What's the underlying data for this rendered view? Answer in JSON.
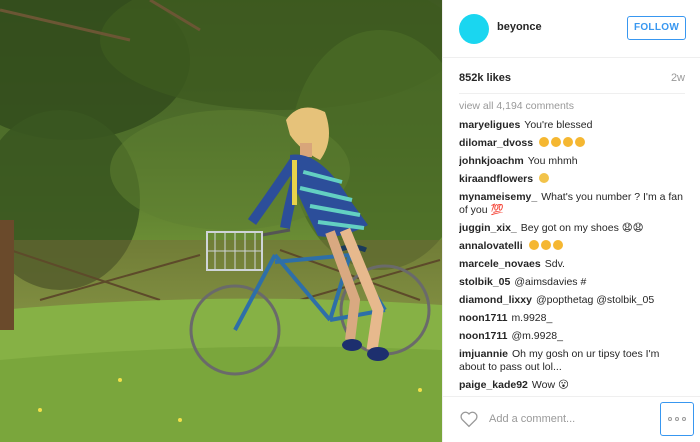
{
  "post": {
    "username": "beyonce",
    "follow_label": "FOLLOW",
    "likes": "852k likes",
    "age": "2w",
    "view_all": "view all 4,194 comments",
    "avatar_color": "#1ad6f0",
    "accent_color": "#3897f0"
  },
  "comments": [
    {
      "user": "maryeligues",
      "text": "You're blessed"
    },
    {
      "user": "dilomar_dvoss",
      "text": "",
      "emoji": [
        "heart-eyes-emoji",
        "heart-eyes-emoji",
        "heart-eyes-emoji",
        "heart-eyes-emoji"
      ]
    },
    {
      "user": "johnkjoachm",
      "text": "You mhmh"
    },
    {
      "user": "kiraandflowers",
      "text": "",
      "emoji": [
        "tongue-emoji"
      ]
    },
    {
      "user": "mynameisemy_",
      "text": "What's you number ? I'm a fan of you 💯"
    },
    {
      "user": "juggin_xix_",
      "text": "Bey got on my shoes 😧😧"
    },
    {
      "user": "annalovatelli",
      "text": "",
      "emoji": [
        "heart-eyes-emoji",
        "heart-eyes-emoji",
        "heart-eyes-emoji"
      ]
    },
    {
      "user": "marcele_novaes",
      "text": "Sdv."
    },
    {
      "user": "stolbik_05",
      "text": "@aimsdavies #"
    },
    {
      "user": "diamond_lixxy",
      "text": "@popthetag @stolbik_05"
    },
    {
      "user": "noon1711",
      "text": "m.9928_"
    },
    {
      "user": "noon1711",
      "text": "@m.9928_"
    },
    {
      "user": "imjuannie",
      "text": "Oh my gosh on ur tipsy toes I'm about to pass out lol..."
    },
    {
      "user": "paige_kade92",
      "text": "Wow 😮"
    }
  ],
  "composer": {
    "placeholder": "Add a comment...",
    "like_icon": "heart-outline-icon",
    "more_icon": "more-options-icon"
  }
}
